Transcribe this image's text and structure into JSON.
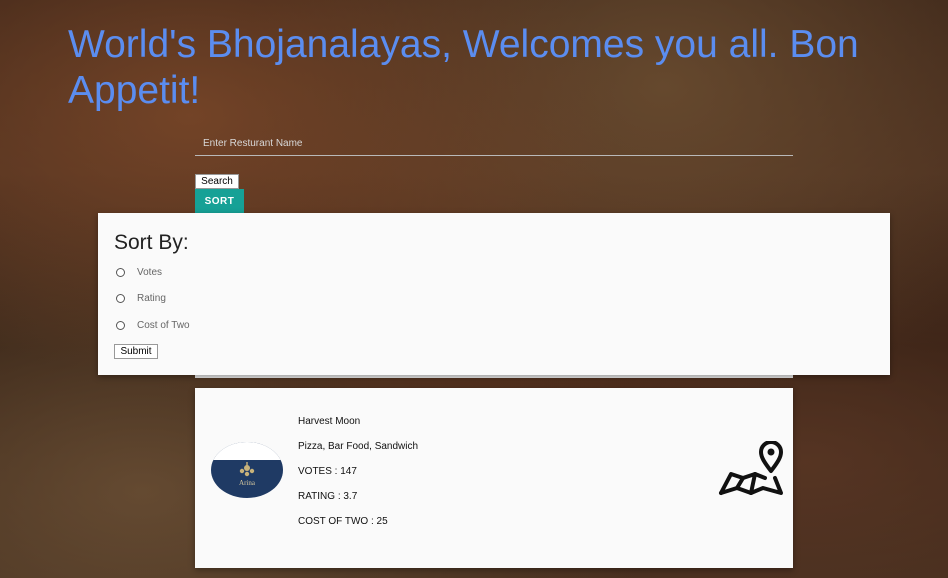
{
  "header": {
    "title": "World's Bhojanalayas, Welcomes you all. Bon Appetit!"
  },
  "search": {
    "placeholder": "Enter Resturant Name",
    "value": "",
    "search_label": "Search",
    "sort_label": "SORT"
  },
  "sort_panel": {
    "heading": "Sort By:",
    "options": [
      {
        "label": "Votes",
        "selected": false
      },
      {
        "label": "Rating",
        "selected": false
      },
      {
        "label": "Cost of Two",
        "selected": false
      }
    ],
    "submit_label": "Submit"
  },
  "restaurant": {
    "logo_text": "Arina",
    "name": "Harvest Moon",
    "cuisines": "Pizza, Bar Food, Sandwich",
    "votes_line": "VOTES : 147",
    "rating_line": "RATING : 3.7",
    "cost_line": "COST OF TWO : 25",
    "map_icon": "map-pin-icon"
  },
  "colors": {
    "title": "#5b8df0",
    "sort_button": "#16a196",
    "panel": "#fafafa"
  }
}
